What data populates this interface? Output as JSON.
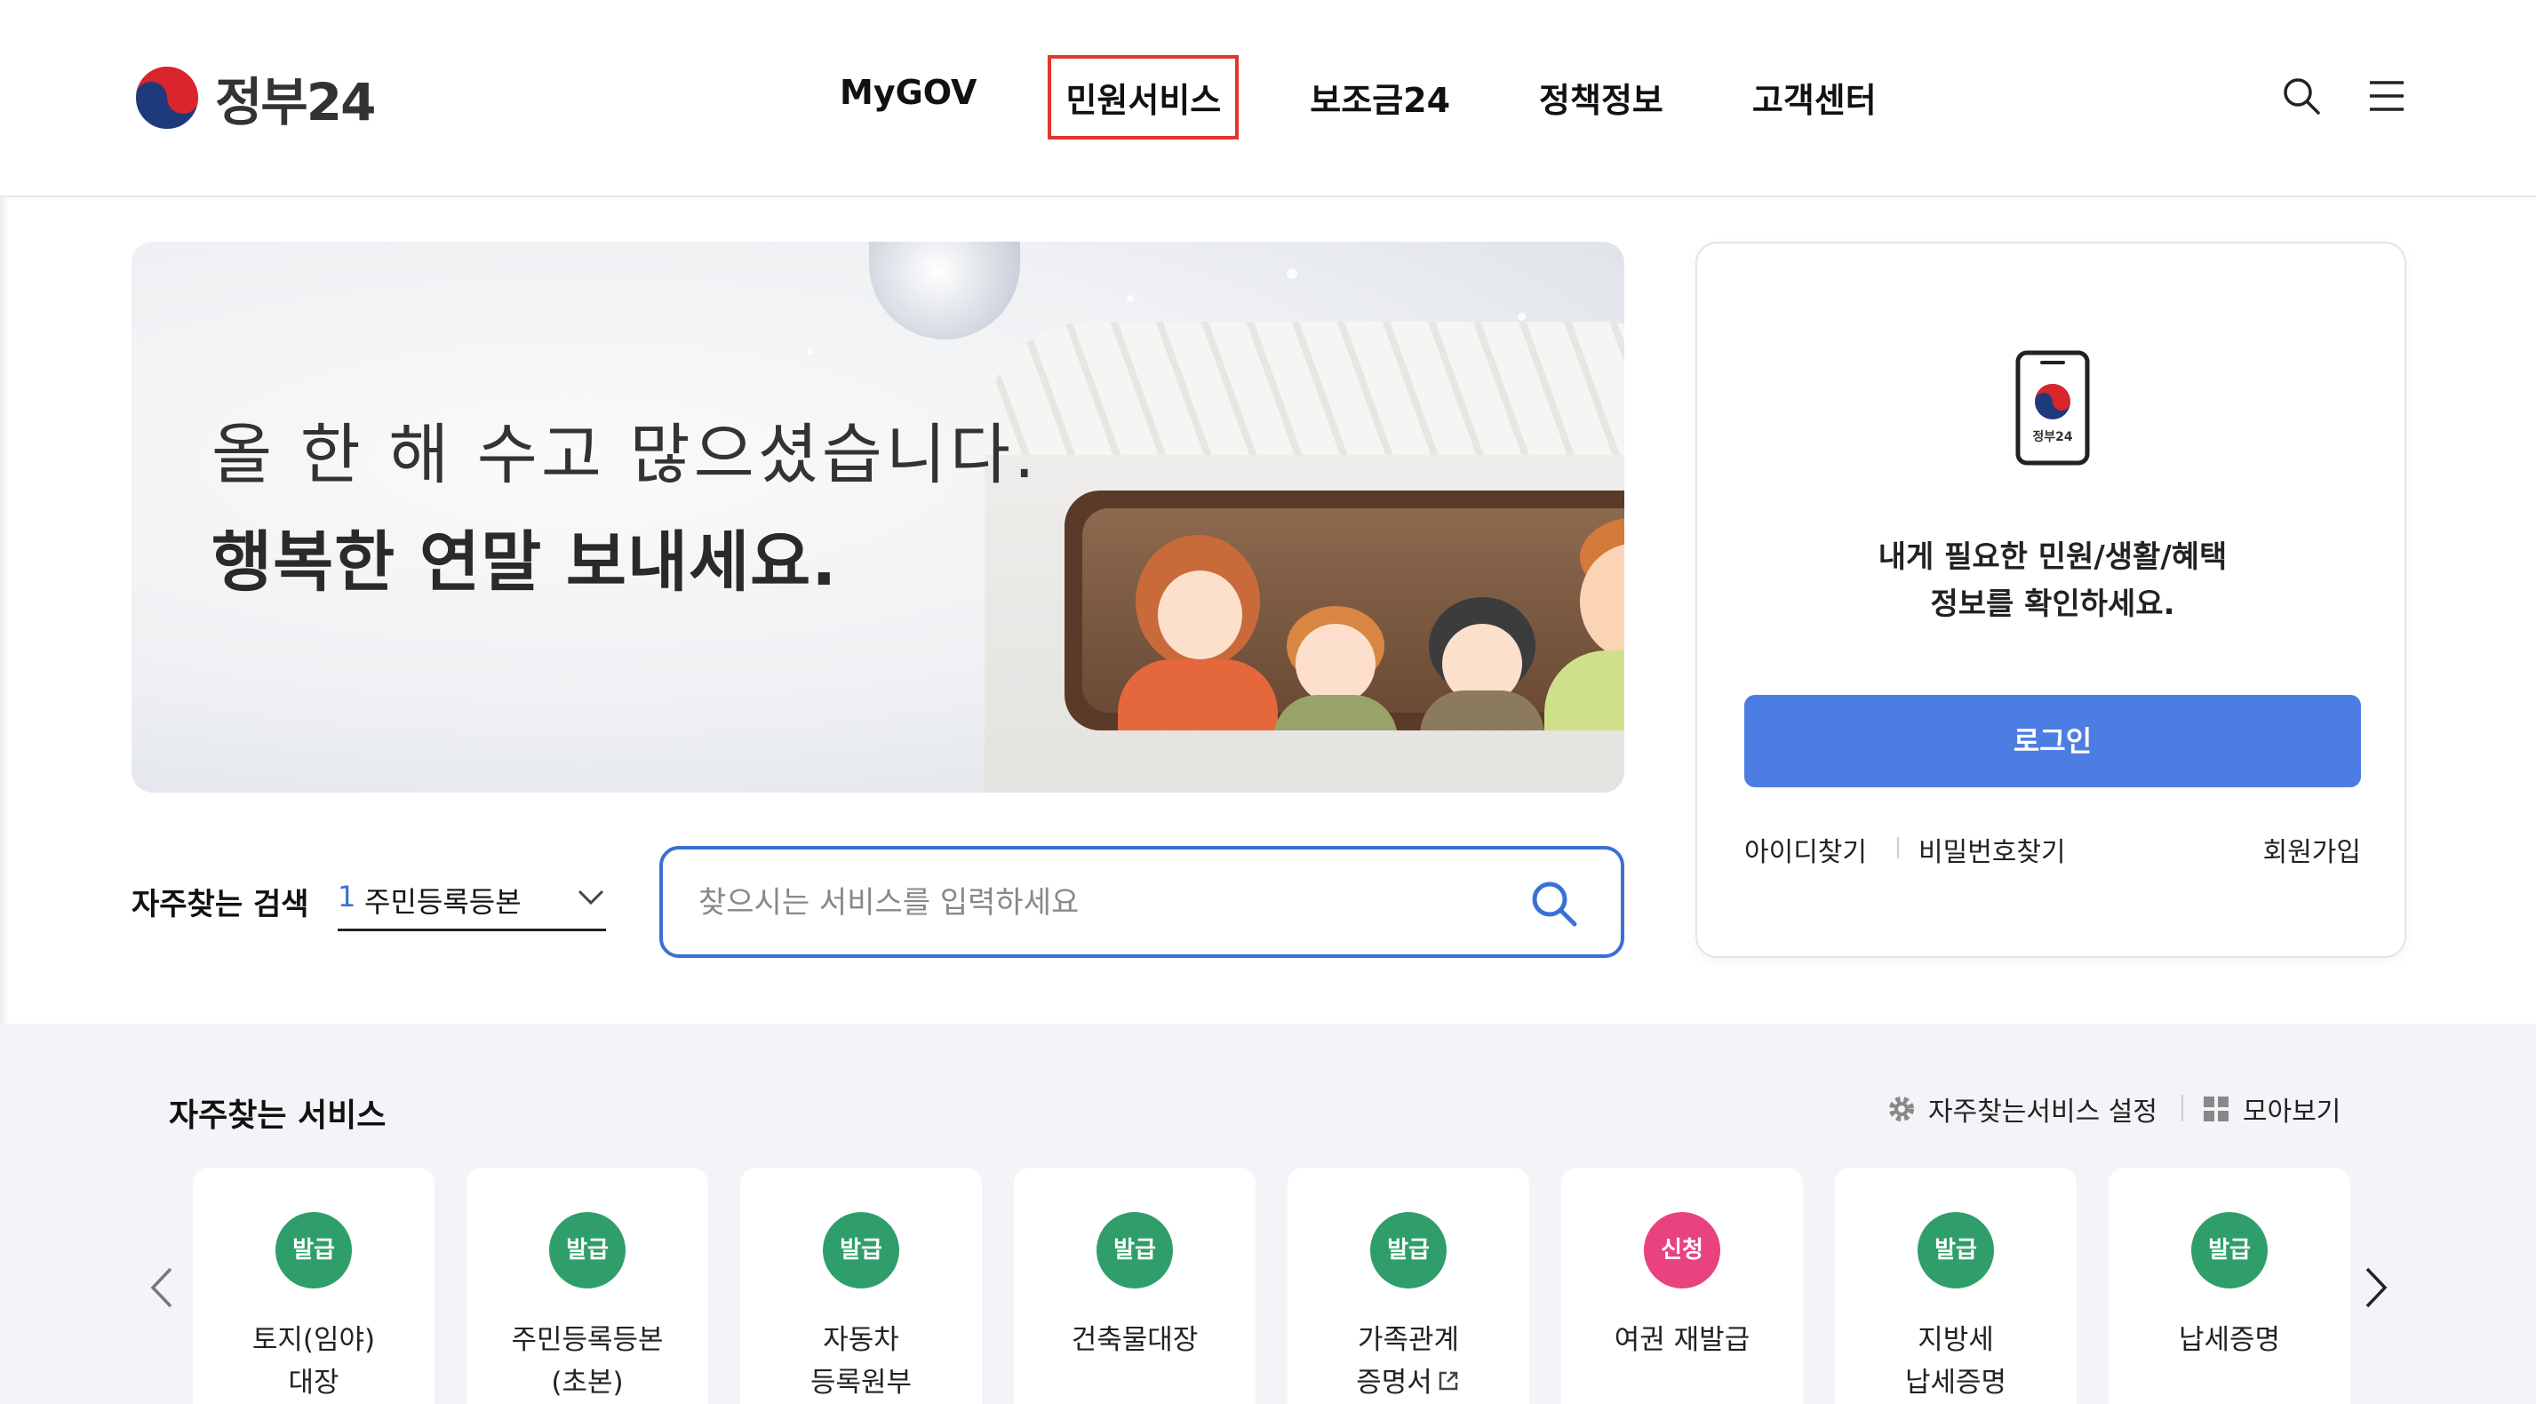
{
  "header": {
    "logo_text": "정부24",
    "nav": [
      "MyGOV",
      "민원서비스",
      "보조금24",
      "정책정보",
      "고객센터"
    ],
    "icons": [
      "search-icon",
      "menu-icon"
    ]
  },
  "banner": {
    "line1": "올 한 해 수고 많으셨습니다.",
    "line2": "행복한 연말 보내세요."
  },
  "login": {
    "app_label": "정부24",
    "desc_line1": "내게 필요한 민원/생활/혜택",
    "desc_line2": "정보를 확인하세요.",
    "button": "로그인",
    "find_id": "아이디찾기",
    "find_pw": "비밀번호찾기",
    "signup": "회원가입"
  },
  "frequent_search": {
    "label": "자주찾는 검색",
    "selected_rank": "1",
    "selected_text": "주민등록등본"
  },
  "search": {
    "placeholder": "찾으시는 서비스를 입력하세요"
  },
  "services": {
    "title": "자주찾는 서비스",
    "settings_label": "자주찾는서비스 설정",
    "collect_label": "모아보기",
    "items": [
      {
        "badge": "발급",
        "type": "issue",
        "line1": "토지(임야)",
        "line2": "대장"
      },
      {
        "badge": "발급",
        "type": "issue",
        "line1": "주민등록등본",
        "line2": "(초본)"
      },
      {
        "badge": "발급",
        "type": "issue",
        "line1": "자동차",
        "line2": "등록원부"
      },
      {
        "badge": "발급",
        "type": "issue",
        "line1": "건축물대장",
        "line2": ""
      },
      {
        "badge": "발급",
        "type": "issue",
        "line1": "가족관계",
        "line2": "증명서"
      },
      {
        "badge": "신청",
        "type": "apply",
        "line1": "여권 재발급",
        "line2": ""
      },
      {
        "badge": "발급",
        "type": "issue",
        "line1": "지방세",
        "line2": "납세증명"
      },
      {
        "badge": "발급",
        "type": "issue",
        "line1": "납세증명",
        "line2": ""
      }
    ]
  },
  "colors": {
    "primary_blue": "#4c7de3",
    "search_border": "#3a6fd6",
    "issue_badge": "#2f9e6a",
    "apply_badge": "#e8427f",
    "active_outline": "#e2362c"
  }
}
